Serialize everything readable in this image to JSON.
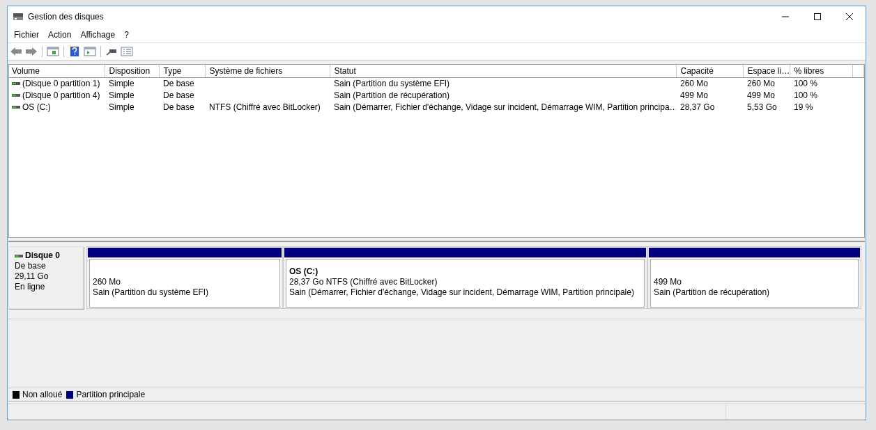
{
  "window": {
    "title": "Gestion des disques"
  },
  "menu": [
    "Fichier",
    "Action",
    "Affichage",
    "?"
  ],
  "table": {
    "columns": [
      "Volume",
      "Disposition",
      "Type",
      "Système de fichiers",
      "Statut",
      "Capacité",
      "Espace li…",
      "% libres"
    ],
    "rows": [
      {
        "cells": [
          "(Disque 0 partition 1)",
          "Simple",
          "De base",
          "",
          "Sain (Partition du système EFI)",
          "260 Mo",
          "260 Mo",
          "100 %"
        ]
      },
      {
        "cells": [
          "(Disque 0 partition 4)",
          "Simple",
          "De base",
          "",
          "Sain (Partition de récupération)",
          "499 Mo",
          "499 Mo",
          "100 %"
        ]
      },
      {
        "cells": [
          "OS (C:)",
          "Simple",
          "De base",
          "NTFS (Chiffré avec BitLocker)",
          "Sain (Démarrer, Fichier d'échange, Vidage sur incident, Démarrage WIM, Partition principa…",
          "28,37 Go",
          "5,53 Go",
          "19 %"
        ]
      }
    ]
  },
  "disk": {
    "name": "Disque 0",
    "type": "De base",
    "size": "29,11 Go",
    "state": "En ligne",
    "partitions": [
      {
        "lines": [
          "260 Mo",
          "Sain (Partition du système EFI)"
        ]
      },
      {
        "title": "OS  (C:)",
        "lines": [
          "28,37 Go NTFS (Chiffré avec BitLocker)",
          "Sain (Démarrer, Fichier d'échange, Vidage sur incident, Démarrage WIM, Partition principale)"
        ]
      },
      {
        "lines": [
          "499 Mo",
          "Sain (Partition de récupération)"
        ]
      }
    ]
  },
  "legend": [
    {
      "label": "Non alloué",
      "color": "#000000"
    },
    {
      "label": "Partition principale",
      "color": "#000080"
    }
  ]
}
